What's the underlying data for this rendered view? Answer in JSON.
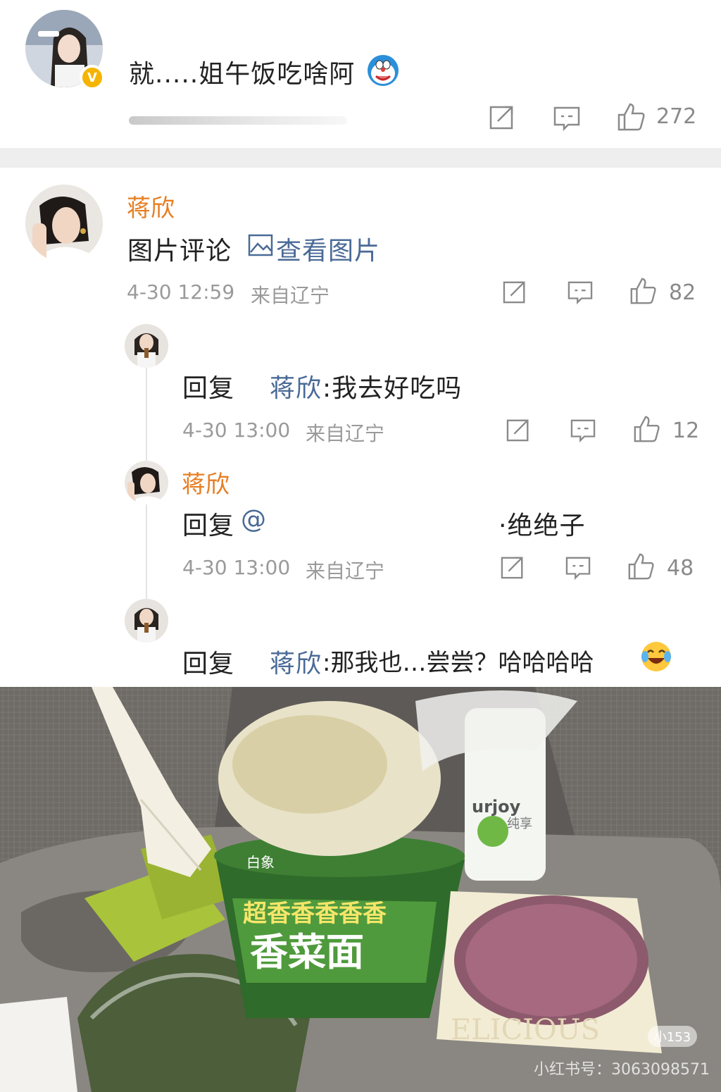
{
  "post": {
    "text": "就.....姐午饭吃啥阿",
    "emoji": "doraemon-face",
    "like_count": "272"
  },
  "comment": {
    "author": "蒋欣",
    "body_prefix": "图片评论",
    "view_image_label": "查看图片",
    "date": "4-30 12:59",
    "location": "来自辽宁",
    "like_count": "82"
  },
  "replies": [
    {
      "reply_label": "回复",
      "mention": "蒋欣",
      "text": ":我去好吃吗",
      "date": "4-30 13:00",
      "location": "来自辽宁",
      "like_count": "12"
    },
    {
      "author": "蒋欣",
      "reply_label": "回复",
      "mention_start": "@",
      "text": "·绝绝子",
      "date": "4-30 13:00",
      "location": "来自辽宁",
      "like_count": "48"
    },
    {
      "reply_label": "回复",
      "mention": "蒋欣",
      "text": ":那我也…尝尝？哈哈哈哈",
      "emoji": "laughing-crying-face"
    }
  ],
  "photo": {
    "cup_brand": "白象",
    "cup_line1": "超香香香香香",
    "cup_line2": "香菜面",
    "bottle_text": "urjoy",
    "bottle_sub": "纯享",
    "ham_pack_text": "ELICIOUS",
    "watermark": "小红书号：3063098571",
    "watermark_badge": "小153"
  },
  "colors": {
    "name_orange": "#e67e22",
    "link_blue": "#4a6a96",
    "meta_gray": "#9a9a9a",
    "divider": "#eeeeee"
  }
}
